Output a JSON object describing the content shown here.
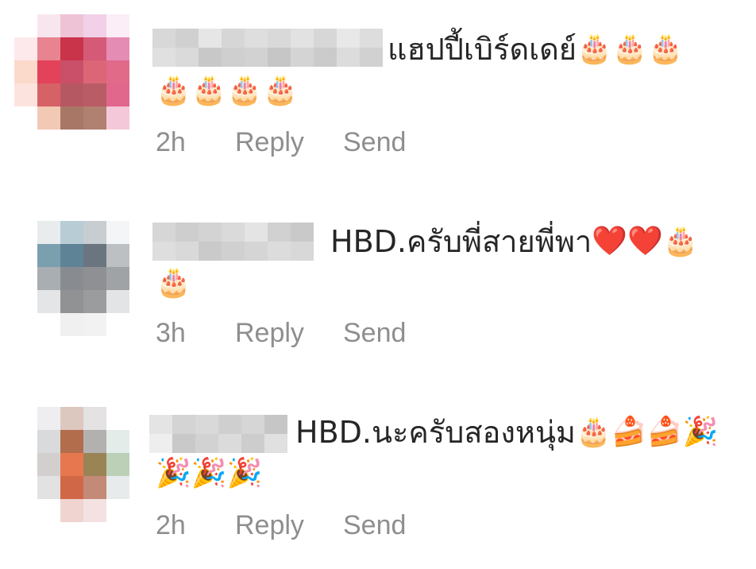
{
  "comments": [
    {
      "text": "แฮปปี้เบิร์ดเดย์",
      "line1_emoji": [
        "🎂",
        "🎂",
        "🎂"
      ],
      "line2_emoji": [
        "🎂",
        "🎂",
        "🎂",
        "🎂"
      ],
      "time": "2h",
      "reply_label": "Reply",
      "send_label": "Send"
    },
    {
      "text": "HBD.ครับพี่สายพี่พา",
      "line1_emoji": [
        "❤️",
        "❤️",
        "🎂"
      ],
      "line2_emoji": [
        "🎂"
      ],
      "time": "3h",
      "reply_label": "Reply",
      "send_label": "Send"
    },
    {
      "text": "HBD.นะครับสองหนุ่ม",
      "line1_emoji": [
        "🎂",
        "🍰",
        "🍰",
        "🎉"
      ],
      "line2_emoji": [
        "🎉",
        "🎉",
        "🎉"
      ],
      "time": "2h",
      "reply_label": "Reply",
      "send_label": "Send"
    }
  ],
  "colors": {
    "text": "#262626",
    "meta": "#8e8e8e",
    "heart": "#e0245e"
  }
}
